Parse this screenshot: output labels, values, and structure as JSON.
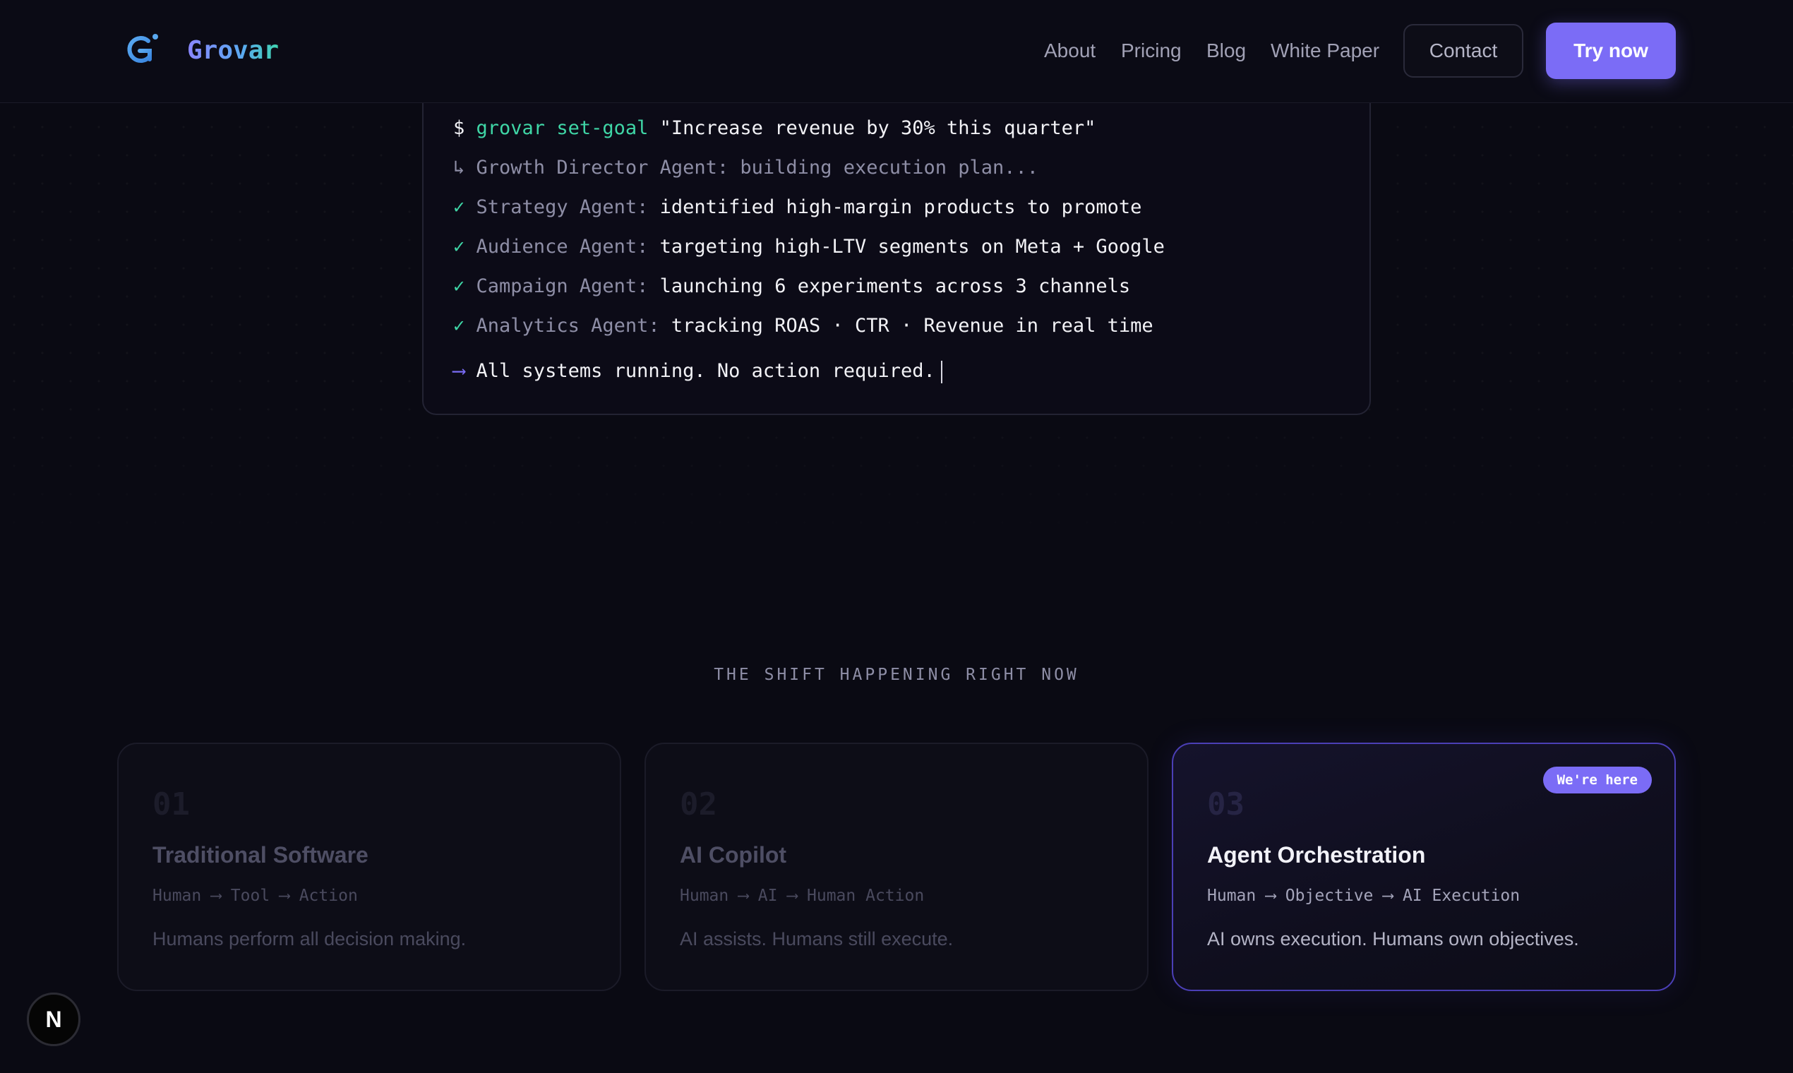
{
  "header": {
    "brand": "Grovar",
    "nav": [
      "About",
      "Pricing",
      "Blog",
      "White Paper"
    ],
    "contact_label": "Contact",
    "try_label": "Try now"
  },
  "terminal": {
    "prompt": "$",
    "command": "grovar set-goal",
    "goal": "\"Increase revenue by 30% this quarter\"",
    "director_prefix": "↳",
    "director_text": "Growth Director Agent: building execution plan...",
    "check_glyph": "✓",
    "agents": [
      {
        "name": "Strategy Agent:",
        "text": "identified high-margin products to promote"
      },
      {
        "name": "Audience Agent:",
        "text": "targeting high-LTV segments on Meta + Google"
      },
      {
        "name": "Campaign Agent:",
        "text": "launching 6 experiments across 3 channels"
      },
      {
        "name": "Analytics Agent:",
        "text": "tracking ROAS · CTR · Revenue in real time"
      }
    ],
    "final_arrow": "⟶",
    "final_text": "All systems running. No action required."
  },
  "section": {
    "eyebrow": "THE SHIFT HAPPENING RIGHT NOW",
    "cards": [
      {
        "num": "01",
        "title": "Traditional Software",
        "flow": "Human ⟶ Tool ⟶ Action",
        "desc": "Humans perform all decision making."
      },
      {
        "num": "02",
        "title": "AI Copilot",
        "flow": "Human ⟶ AI ⟶ Human Action",
        "desc": "AI assists. Humans still execute."
      },
      {
        "num": "03",
        "title": "Agent Orchestration",
        "flow": "Human ⟶ Objective ⟶ AI Execution",
        "desc": "AI owns execution. Humans own objectives.",
        "badge": "We're here"
      }
    ]
  },
  "dev_badge": "N"
}
